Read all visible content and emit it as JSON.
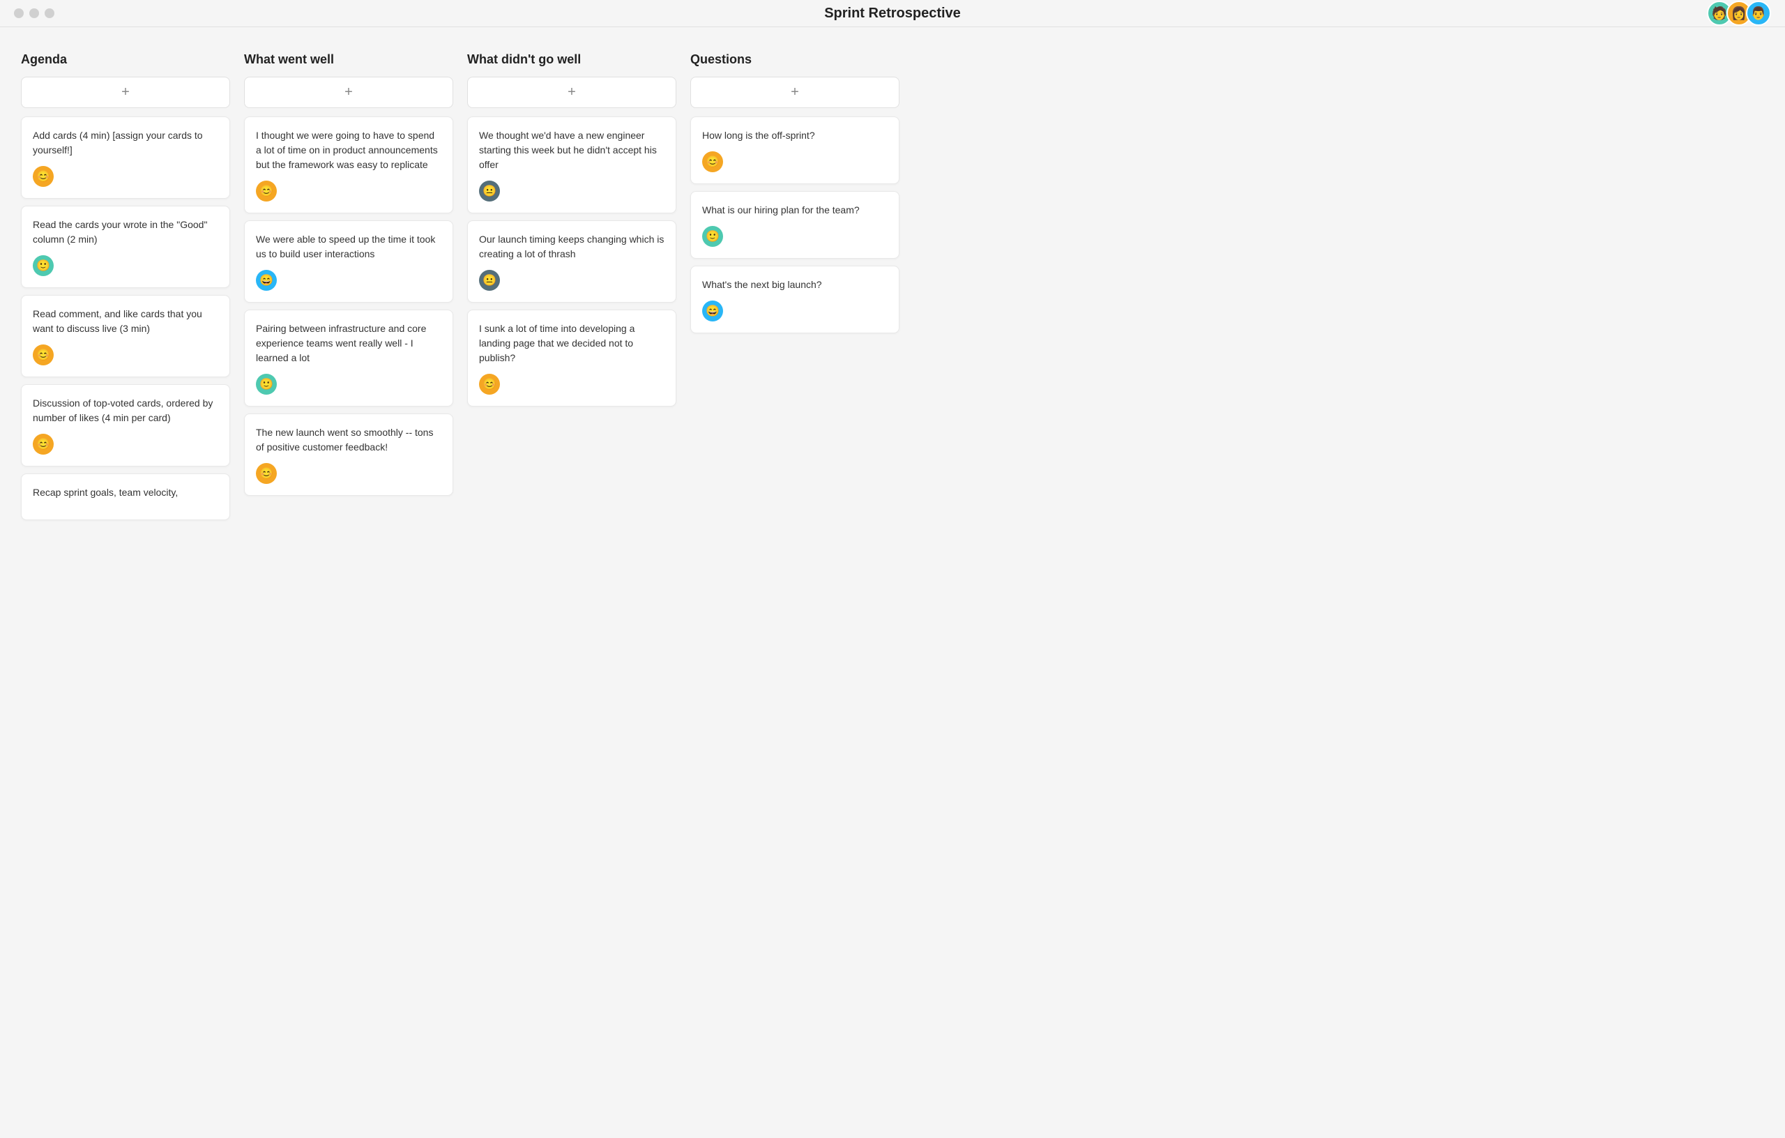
{
  "header": {
    "title": "Sprint Retrospective",
    "users": [
      {
        "color": "#4ec9b0",
        "emoji": "🧑"
      },
      {
        "color": "#f5a623",
        "emoji": "👩"
      },
      {
        "color": "#29b6f6",
        "emoji": "👨"
      }
    ]
  },
  "columns": [
    {
      "id": "agenda",
      "title": "Agenda",
      "add_label": "+",
      "cards": [
        {
          "text": "Add cards (4 min) [assign your cards to yourself!]",
          "avatar_color": "#f5a623",
          "avatar_class": "av-orange"
        },
        {
          "text": "Read the cards your wrote in the \"Good\" column (2 min)",
          "avatar_color": "#4ec9b0",
          "avatar_class": "av-teal"
        },
        {
          "text": "Read comment, and like cards that you want to discuss live (3 min)",
          "avatar_color": "#f5a623",
          "avatar_class": "av-orange"
        },
        {
          "text": "Discussion of top-voted cards, ordered by number of likes (4 min per card)",
          "avatar_color": "#f5a623",
          "avatar_class": "av-orange"
        },
        {
          "text": "Recap sprint goals, team velocity,",
          "avatar_color": null,
          "avatar_class": null
        }
      ]
    },
    {
      "id": "went-well",
      "title": "What went well",
      "add_label": "+",
      "cards": [
        {
          "text": "I thought we were going to have to spend a lot of time on in product announcements but the framework was easy to replicate",
          "avatar_color": "#f5a623",
          "avatar_class": "av-orange"
        },
        {
          "text": "We were able to speed up the time it took us to build user interactions",
          "avatar_color": "#29b6f6",
          "avatar_class": "av-blue"
        },
        {
          "text": "Pairing between infrastructure and core experience teams went really well - I learned a lot",
          "avatar_color": "#4ec9b0",
          "avatar_class": "av-teal"
        },
        {
          "text": "The new launch went so smoothly -- tons of positive customer feedback!",
          "avatar_color": "#f5a623",
          "avatar_class": "av-orange"
        }
      ]
    },
    {
      "id": "didnt-go-well",
      "title": "What didn't go well",
      "add_label": "+",
      "cards": [
        {
          "text": "We thought we'd have a new engineer starting this week but he didn't accept his offer",
          "avatar_color": "#546e7a",
          "avatar_class": "av-dark"
        },
        {
          "text": "Our launch timing keeps changing which is creating a lot of thrash",
          "avatar_color": "#546e7a",
          "avatar_class": "av-dark"
        },
        {
          "text": "I sunk a lot of time into developing a landing page that we decided not to publish?",
          "avatar_color": "#f5a623",
          "avatar_class": "av-orange"
        }
      ]
    },
    {
      "id": "questions",
      "title": "Questions",
      "add_label": "+",
      "cards": [
        {
          "text": "How long is the off-sprint?",
          "avatar_color": "#f5a623",
          "avatar_class": "av-orange"
        },
        {
          "text": "What is our hiring plan for the team?",
          "avatar_color": "#4ec9b0",
          "avatar_class": "av-teal"
        },
        {
          "text": "What's the next big launch?",
          "avatar_color": "#29b6f6",
          "avatar_class": "av-blue"
        }
      ]
    }
  ]
}
